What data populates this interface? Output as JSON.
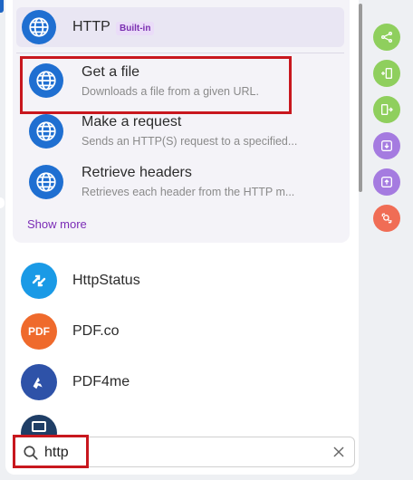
{
  "http_module": {
    "title": "HTTP",
    "badge": "Built-in",
    "actions": [
      {
        "title": "Get a file",
        "description": "Downloads a file from a given URL."
      },
      {
        "title": "Make a request",
        "description": "Sends an HTTP(S) request to a specified..."
      },
      {
        "title": "Retrieve headers",
        "description": "Retrieves each header from the HTTP m..."
      }
    ],
    "show_more": "Show more"
  },
  "apps": [
    {
      "name": "HttpStatus",
      "icon": "httpstatus-icon",
      "color": "#1a9ae6"
    },
    {
      "name": "PDF.co",
      "icon": "pdfco-icon",
      "color": "#ef6a2c",
      "icon_text": "PDF"
    },
    {
      "name": "PDF4me",
      "icon": "pdf4me-icon",
      "color": "#2e52a8"
    }
  ],
  "search": {
    "value": "http",
    "placeholder": ""
  },
  "side_toolbar": [
    {
      "icon": "share-icon",
      "color": "#8fcf5d"
    },
    {
      "icon": "insert-icon",
      "color": "#8fcf5d"
    },
    {
      "icon": "export-icon",
      "color": "#8fcf5d"
    },
    {
      "icon": "download-icon",
      "color": "#a57be0"
    },
    {
      "icon": "upload-icon",
      "color": "#a57be0"
    },
    {
      "icon": "search-plus-icon",
      "color": "#f06d55"
    }
  ],
  "colors": {
    "accent": "#7b2cb6",
    "highlight": "#c8171e",
    "globe": "#1f6fd1"
  }
}
